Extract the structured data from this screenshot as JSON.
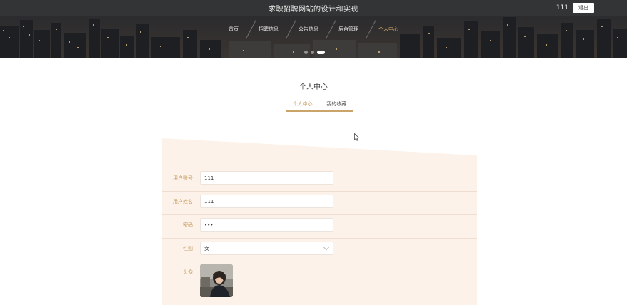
{
  "header": {
    "site_title": "求职招聘网站的设计和实现",
    "username": "111",
    "logout_label": "退出"
  },
  "nav": {
    "items": [
      {
        "label": "首页",
        "active": false
      },
      {
        "label": "招聘信息",
        "active": false
      },
      {
        "label": "公告信息",
        "active": false
      },
      {
        "label": "后台管理",
        "active": false
      },
      {
        "label": "个人中心",
        "active": true
      }
    ]
  },
  "carousel": {
    "slide_count": 3,
    "active_index": 2
  },
  "page": {
    "title": "个人中心",
    "tabs": [
      {
        "label": "个人中心",
        "active": true
      },
      {
        "label": "我的收藏",
        "active": false
      }
    ]
  },
  "form": {
    "account_label": "用户账号",
    "account_value": "111",
    "name_label": "用户姓名",
    "name_value": "111",
    "password_label": "密码",
    "password_value": "•••",
    "gender_label": "性别",
    "gender_value": "女",
    "avatar_label": "头像"
  },
  "colors": {
    "topbar": "#333435",
    "accent": "#caa468",
    "panel": "#fcf2ea",
    "label": "#c79d5f"
  }
}
